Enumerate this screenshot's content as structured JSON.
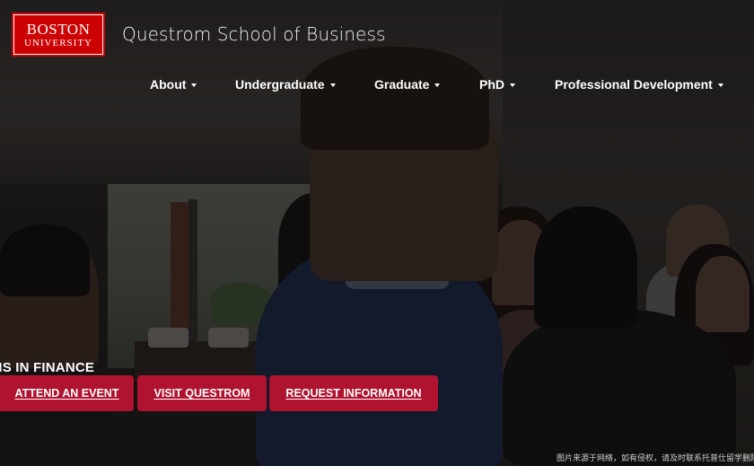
{
  "header": {
    "logo_line1": "BOSTON",
    "logo_line2": "UNIVERSITY",
    "school_name": "Questrom School of Business"
  },
  "nav": {
    "items": [
      {
        "label": "About",
        "icon": "caret-down-icon"
      },
      {
        "label": "Undergraduate",
        "icon": "caret-down-icon"
      },
      {
        "label": "Graduate",
        "icon": "caret-down-icon"
      },
      {
        "label": "PhD",
        "icon": "caret-down-icon"
      },
      {
        "label": "Professional Development",
        "icon": "caret-down-icon"
      }
    ]
  },
  "hero": {
    "program_heading": "MS IN FINANCE",
    "buttons": {
      "attend_event": "ATTEND AN EVENT",
      "visit": "VISIT QUESTROM",
      "request_info": "REQUEST INFORMATION"
    }
  },
  "watermark": "图片来源于网络，如有侵权，请及时联系托普仕留学删除",
  "colors": {
    "brand_red": "#cc0000",
    "cta_red": "#b0132f",
    "text": "#ffffff"
  }
}
